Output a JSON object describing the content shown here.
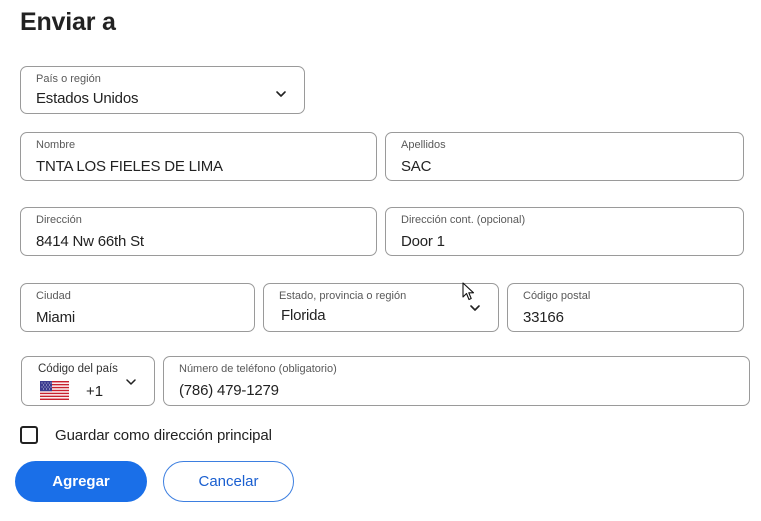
{
  "heading": "Enviar a",
  "country": {
    "label": "País o región",
    "value": "Estados Unidos"
  },
  "first_name": {
    "label": "Nombre",
    "value": "TNTA LOS FIELES DE LIMA"
  },
  "last_name": {
    "label": "Apellidos",
    "value": "SAC"
  },
  "address": {
    "label": "Dirección",
    "value": "8414 Nw 66th St"
  },
  "address2": {
    "label": "Dirección cont. (opcional)",
    "value": "Door 1"
  },
  "city": {
    "label": "Ciudad",
    "value": "Miami"
  },
  "state": {
    "label": "Estado, provincia o región",
    "value": "Florida"
  },
  "postal_code": {
    "label": "Código postal",
    "value": "33166"
  },
  "country_code": {
    "label": "Código del país",
    "value": "+1",
    "flag_icon": "us-flag-icon"
  },
  "phone": {
    "label": "Número de teléfono (obligatorio)",
    "value": "(786) 479-1279"
  },
  "save_as_primary": {
    "label": "Guardar como dirección principal",
    "checked": false
  },
  "buttons": {
    "add": "Agregar",
    "cancel": "Cancelar"
  },
  "colors": {
    "primary": "#1a6fe8",
    "secondary_text": "#1a5fd0",
    "border": "#9a9a9a"
  }
}
